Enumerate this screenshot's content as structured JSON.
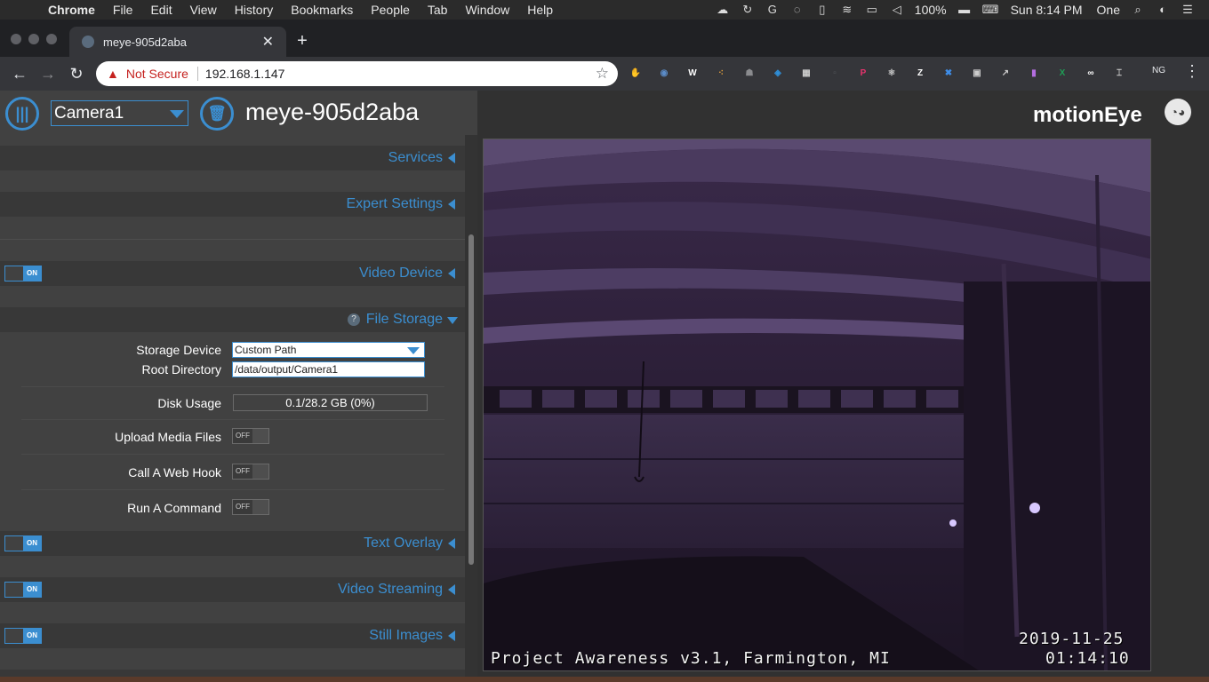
{
  "menubar": {
    "apple_icon": "apple-icon",
    "items": [
      "Chrome",
      "File",
      "Edit",
      "View",
      "History",
      "Bookmarks",
      "People",
      "Tab",
      "Window",
      "Help"
    ],
    "battery": "100%",
    "clock": "Sun 8:14 PM",
    "user": "One"
  },
  "browser": {
    "tab_title": "meye-905d2aba",
    "security_label": "Not Secure",
    "url": "192.168.1.147",
    "profile_initials": "NG",
    "extensions": [
      {
        "icon": "hand-ext-icon",
        "color": "#d93025",
        "glyph": "✋"
      },
      {
        "icon": "eye-ext-icon",
        "color": "#5b8cc8",
        "glyph": "◉"
      },
      {
        "icon": "w-ext-icon",
        "color": "#ffffff",
        "glyph": "W"
      },
      {
        "icon": "dots-ext-icon",
        "color": "#e8a33d",
        "glyph": "⁖"
      },
      {
        "icon": "person-ext-icon",
        "color": "#8a8b8e",
        "glyph": "☗"
      },
      {
        "icon": "shield-ext-icon",
        "color": "#2f8fd8",
        "glyph": "◈"
      },
      {
        "icon": "grid-ext-icon",
        "color": "#cccccc",
        "glyph": "▦"
      },
      {
        "icon": "faded-ext-icon",
        "color": "#55575b",
        "glyph": "▫"
      },
      {
        "icon": "ping-ext-icon",
        "color": "#e8336e",
        "glyph": "P"
      },
      {
        "icon": "react-ext-icon",
        "color": "#cccccc",
        "glyph": "⚛"
      },
      {
        "icon": "z-ext-icon",
        "color": "#ffffff",
        "glyph": "Z"
      },
      {
        "icon": "x-ext-icon",
        "color": "#3e8de8",
        "glyph": "✖"
      },
      {
        "icon": "square-ext-icon",
        "color": "#cccccc",
        "glyph": "▣"
      },
      {
        "icon": "arrow-ext-icon",
        "color": "#cccccc",
        "glyph": "↗"
      },
      {
        "icon": "purple-ext-icon",
        "color": "#b46ee0",
        "glyph": "▮"
      },
      {
        "icon": "excel-ext-icon",
        "color": "#1f9d55",
        "glyph": "X"
      },
      {
        "icon": "glasses-ext-icon",
        "color": "#ffffff",
        "glyph": "∞"
      },
      {
        "icon": "cast-ext-icon",
        "color": "#cccccc",
        "glyph": "⌶"
      }
    ]
  },
  "header": {
    "camera_selected": "Camera1",
    "device_name": "meye-905d2aba",
    "brand": "motionEye"
  },
  "sections": {
    "services": {
      "title": "Services"
    },
    "expert_settings": {
      "title": "Expert Settings"
    },
    "video_device": {
      "title": "Video Device",
      "toggle": "ON"
    },
    "file_storage": {
      "title": "File Storage",
      "help": "?"
    },
    "text_overlay": {
      "title": "Text Overlay",
      "toggle": "ON"
    },
    "video_streaming": {
      "title": "Video Streaming",
      "toggle": "ON"
    },
    "still_images": {
      "title": "Still Images",
      "toggle": "ON"
    }
  },
  "file_storage": {
    "storage_device_label": "Storage Device",
    "storage_device_value": "Custom Path",
    "root_directory_label": "Root Directory",
    "root_directory_value": "/data/output/Camera1",
    "disk_usage_label": "Disk Usage",
    "disk_usage_value": "0.1/28.2 GB (0%)",
    "upload_media_label": "Upload Media Files",
    "upload_media_toggle": "OFF",
    "web_hook_label": "Call A Web Hook",
    "web_hook_toggle": "OFF",
    "run_command_label": "Run A Command",
    "run_command_toggle": "OFF"
  },
  "camera_frame": {
    "overlay_left": "Project Awareness v3.1, Farmington, MI",
    "overlay_date": "2019-11-25",
    "overlay_time": "01:14:10"
  },
  "colors": {
    "accent": "#3b8ed0",
    "panel": "#414141",
    "night_purple": "#2e1f3a"
  }
}
